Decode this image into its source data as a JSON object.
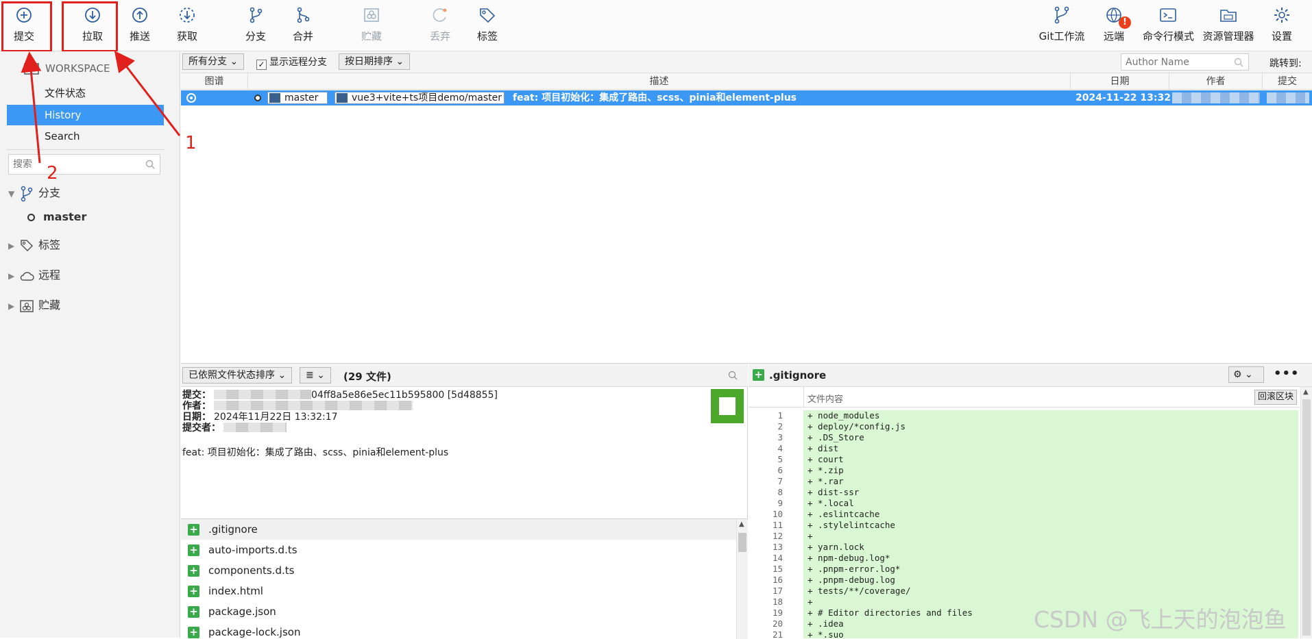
{
  "toolbar": {
    "commit": "提交",
    "pull": "拉取",
    "push": "推送",
    "fetch": "获取",
    "branch": "分支",
    "merge": "合并",
    "stash": "贮藏",
    "discard": "丢弃",
    "tag": "标签",
    "gitflow": "Git工作流",
    "remote": "远端",
    "terminal": "命令行模式",
    "explorer": "资源管理器",
    "settings": "设置",
    "remote_badge": "!"
  },
  "annotations": {
    "n1": "1",
    "n2": "2"
  },
  "sidebar": {
    "workspace": "WORKSPACE",
    "file_status": "文件状态",
    "history": "History",
    "search": "Search",
    "search_placeholder": "搜索",
    "branches": "分支",
    "master": "master",
    "tags": "标签",
    "remotes": "远程",
    "stashes": "贮藏"
  },
  "filter": {
    "all_branches": "所有分支",
    "show_remote": "显示远程分支",
    "sort_date": "按日期排序",
    "author_placeholder": "Author Name",
    "jump_to": "跳转到:"
  },
  "table": {
    "headers": {
      "graph": "图谱",
      "desc": "描述",
      "date": "日期",
      "author": "作者",
      "commit": "提交"
    },
    "row": {
      "local_branch": "master",
      "remote_branch": "vue3+vite+ts项目demo/master",
      "message": "feat: 项目初始化：集成了路由、scss、pinia和element-plus",
      "date": "2024-11-22 13:32"
    }
  },
  "details": {
    "sort_label": "已依照文件状态排序",
    "list_icon": "≣",
    "file_count": "(29 文件)",
    "commit_label": "提交：",
    "commit_hash_tail": "04ff8a5e86e5ec11b595800 [5d48855]",
    "author_label": "作者：",
    "date_label": "日期：",
    "date_value": "2024年11月22日 13:32:17",
    "committer_label": "提交者：",
    "message": "feat: 项目初始化：集成了路由、scss、pinia和element-plus"
  },
  "files": [
    ".gitignore",
    "auto-imports.d.ts",
    "components.d.ts",
    "index.html",
    "package.json",
    "package-lock.json"
  ],
  "diff": {
    "file": ".gitignore",
    "content_label": "文件内容",
    "rollback": "回滚区块",
    "lines": [
      {
        "n": "1",
        "t": "+ node_modules"
      },
      {
        "n": "2",
        "t": "+ deploy/*config.js"
      },
      {
        "n": "3",
        "t": "+ .DS_Store"
      },
      {
        "n": "4",
        "t": "+ dist"
      },
      {
        "n": "5",
        "t": "+ court"
      },
      {
        "n": "6",
        "t": "+ *.zip"
      },
      {
        "n": "7",
        "t": "+ *.rar"
      },
      {
        "n": "8",
        "t": "+ dist-ssr"
      },
      {
        "n": "9",
        "t": "+ *.local"
      },
      {
        "n": "10",
        "t": "+ .eslintcache"
      },
      {
        "n": "11",
        "t": "+ .stylelintcache"
      },
      {
        "n": "12",
        "t": "+"
      },
      {
        "n": "13",
        "t": "+ yarn.lock"
      },
      {
        "n": "14",
        "t": "+ npm-debug.log*"
      },
      {
        "n": "15",
        "t": "+ .pnpm-error.log*"
      },
      {
        "n": "16",
        "t": "+ .pnpm-debug.log"
      },
      {
        "n": "17",
        "t": "+ tests/**/coverage/"
      },
      {
        "n": "18",
        "t": "+"
      },
      {
        "n": "19",
        "t": "+ # Editor directories and files"
      },
      {
        "n": "20",
        "t": "+ .idea"
      },
      {
        "n": "21",
        "t": "+ *.suo"
      }
    ]
  },
  "watermark": "CSDN @飞上天的泡泡鱼",
  "colors": {
    "accent": "#3b98f5",
    "annotation": "#e0201c",
    "added": "#d9f7d3",
    "file_added": "#3aa94a"
  }
}
